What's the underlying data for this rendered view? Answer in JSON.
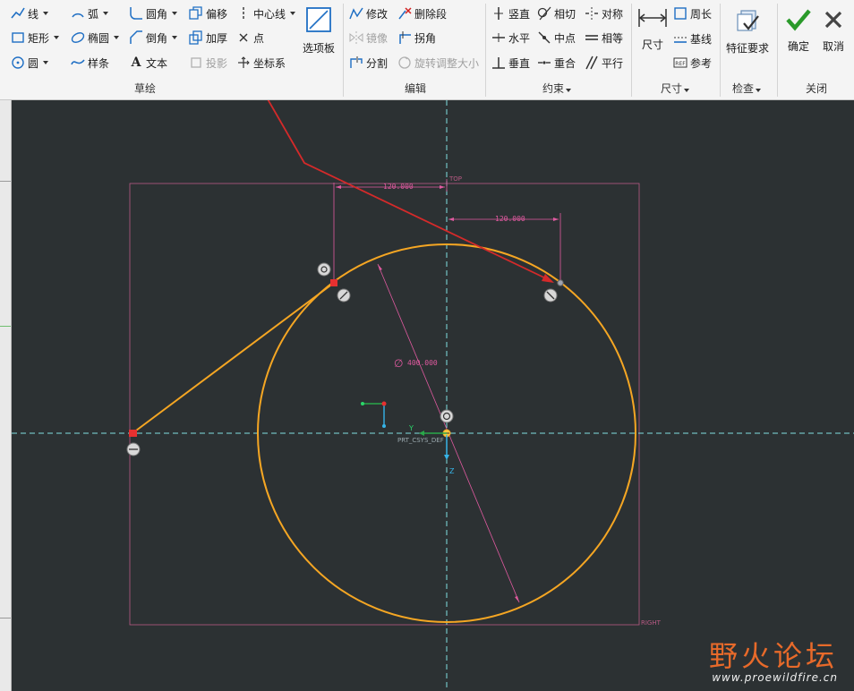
{
  "ribbon": {
    "sketch": {
      "group_label": "草绘",
      "line": "线",
      "arc": "弧",
      "fillet": "圆角",
      "offset": "偏移",
      "centerline": "中心线",
      "rectangle": "矩形",
      "ellipse": "椭圆",
      "chamfer": "倒角",
      "thicken": "加厚",
      "point": "点",
      "circle": "圆",
      "spline": "样条",
      "text": "文本",
      "project": "投影",
      "coordsys": "坐标系",
      "palette": "选项板"
    },
    "edit": {
      "group_label": "编辑",
      "modify": "修改",
      "delete_segment": "删除段",
      "mirror": "镜像",
      "corner": "拐角",
      "divide": "分割",
      "rotate_resize": "旋转调整大小"
    },
    "constrain": {
      "group_label": "约束",
      "vertical": "竖直",
      "tangent": "相切",
      "symmetric": "对称",
      "horizontal": "水平",
      "midpoint": "中点",
      "equal": "相等",
      "perpendicular": "垂直",
      "coincident": "重合",
      "parallel": "平行"
    },
    "dimension": {
      "group_label": "尺寸",
      "dimension": "尺寸",
      "perimeter": "周长",
      "baseline": "基线",
      "reference": "参考"
    },
    "inspect": {
      "group_label": "检查",
      "feature_requirements": "特征要求"
    },
    "close": {
      "group_label": "关闭",
      "ok": "确定",
      "cancel": "取消"
    }
  },
  "sketch": {
    "dim_top": "120.000",
    "dim_right": "120.000",
    "dim_diameter": "400.000",
    "diameter_symbol": "∅",
    "plane_top": "TOP",
    "plane_right": "RIGHT",
    "csys_label": "PRT_CSYS_DEF",
    "axis_y": "Y",
    "axis_z": "Z",
    "colors": {
      "background": "#2c3133",
      "geometry": "#f5a623",
      "dimension": "#e05aa0",
      "centerline": "#7fe0e0",
      "annotation_arrow": "#d42a2a"
    }
  },
  "watermark": {
    "title": "野火论坛",
    "url": "www.proewildfire.cn"
  }
}
